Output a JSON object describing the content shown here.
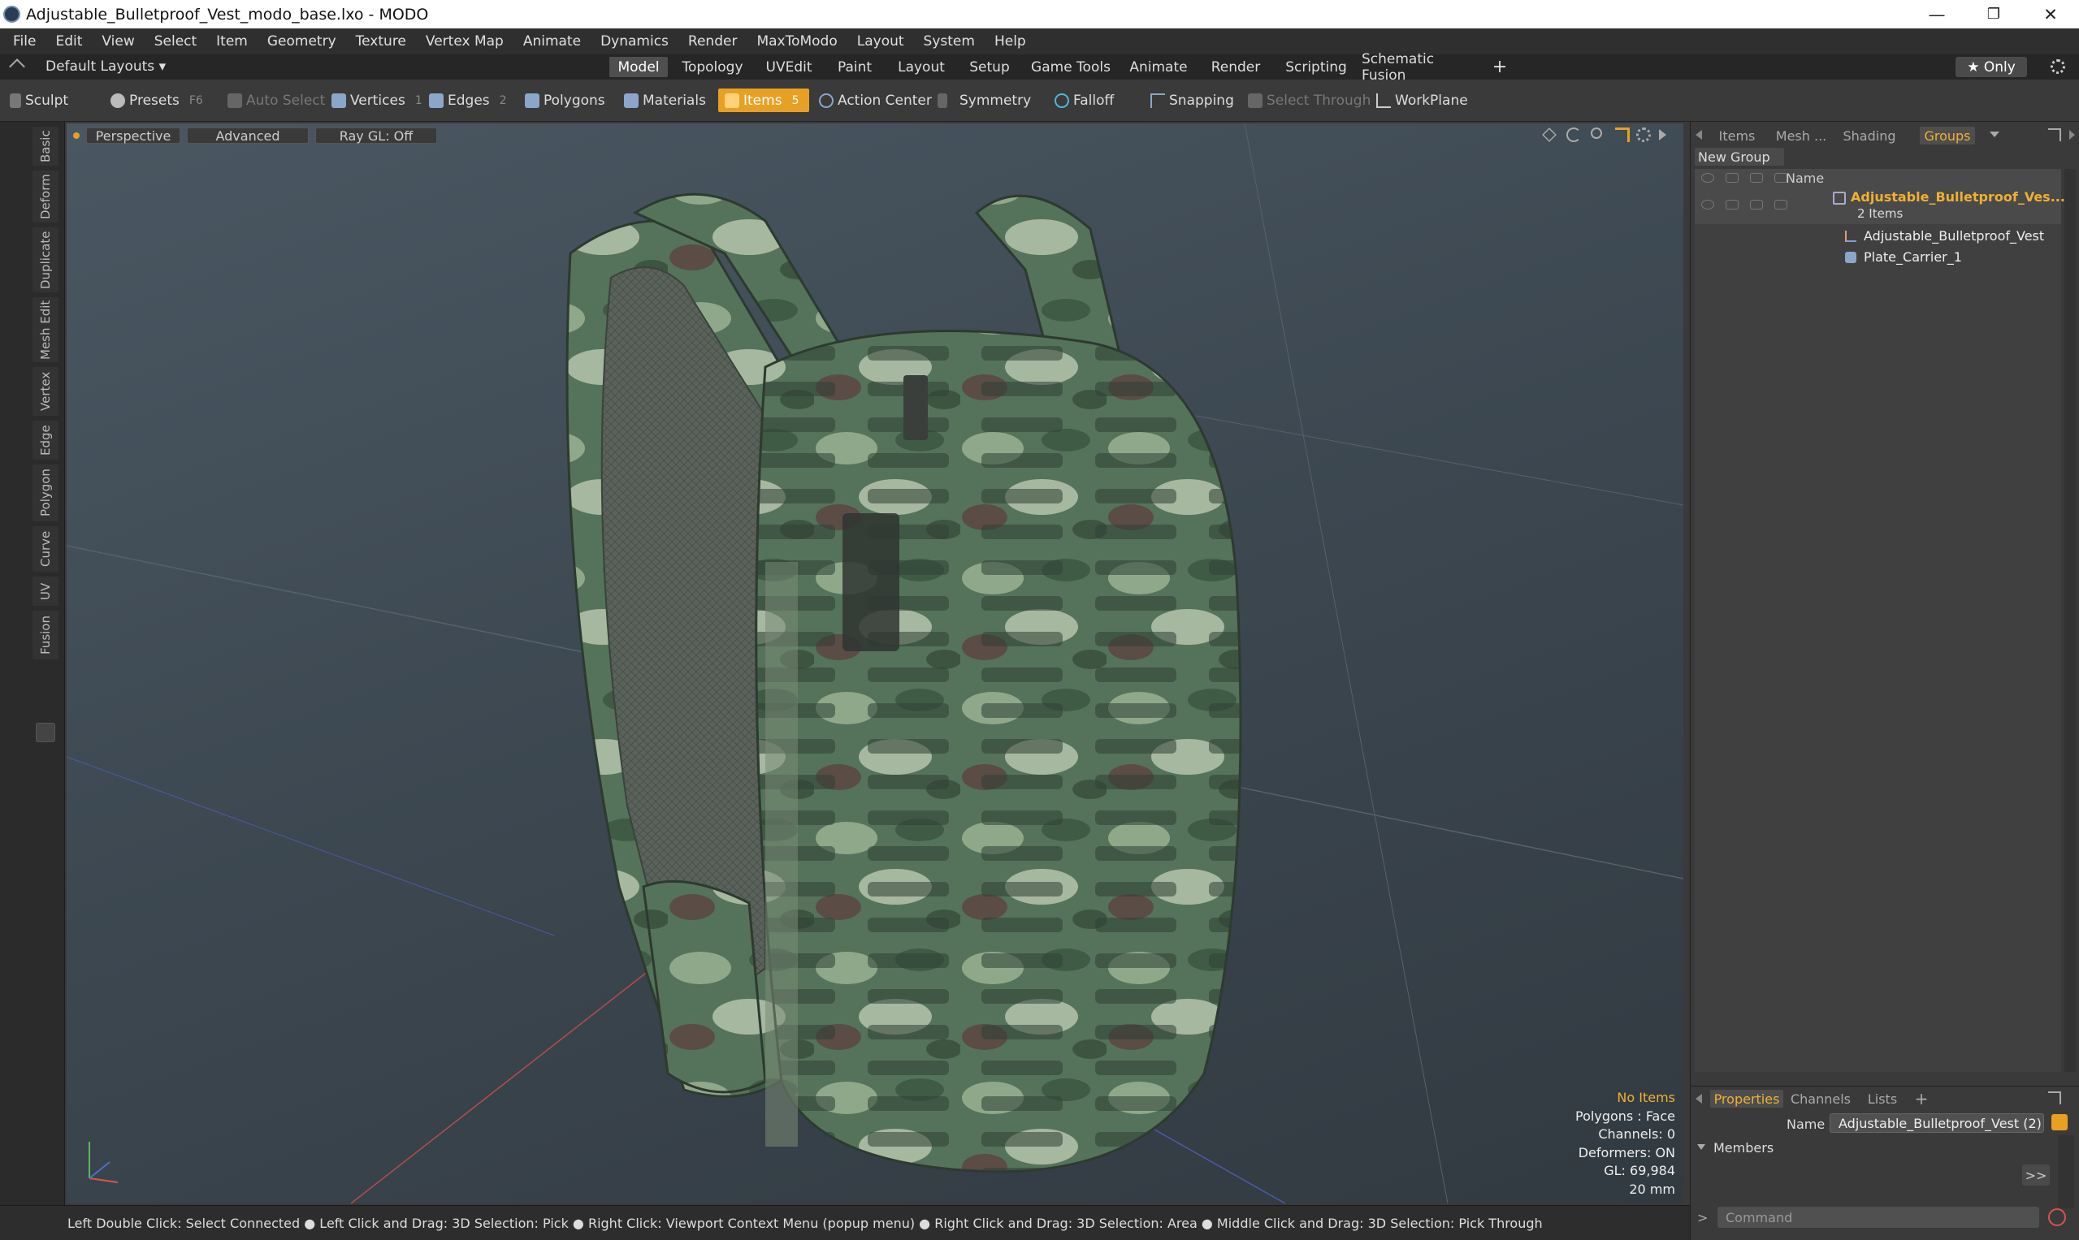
{
  "window": {
    "title": "Adjustable_Bulletproof_Vest_modo_base.lxo - MODO",
    "minimize": "—",
    "restore": "❐",
    "close": "✕"
  },
  "menu": [
    "File",
    "Edit",
    "View",
    "Select",
    "Item",
    "Geometry",
    "Texture",
    "Vertex Map",
    "Animate",
    "Dynamics",
    "Render",
    "MaxToModo",
    "Layout",
    "System",
    "Help"
  ],
  "layoutbar": {
    "layouts_label": "Default Layouts ▾",
    "tabs": [
      "Model",
      "Topology",
      "UVEdit",
      "Paint",
      "Layout",
      "Setup",
      "Game Tools",
      "Animate",
      "Render",
      "Scripting",
      "Schematic Fusion"
    ],
    "active_tab": "Model",
    "add": "+",
    "only_label": "★ Only"
  },
  "toolbar": {
    "sculpt": "Sculpt",
    "presets": "Presets",
    "presets_key": "F6",
    "auto_select": "Auto Select",
    "vertices": "Vertices",
    "vertices_n": "1",
    "edges": "Edges",
    "edges_n": "2",
    "polygons": "Polygons",
    "materials": "Materials",
    "items": "Items",
    "items_n": "5",
    "action_center": "Action Center",
    "symmetry": "Symmetry",
    "falloff": "Falloff",
    "snapping": "Snapping",
    "select_through": "Select Through",
    "workplane": "WorkPlane"
  },
  "left_tabs": [
    "Basic",
    "Deform",
    "Duplicate",
    "Mesh Edit",
    "Vertex",
    "Edge",
    "Polygon",
    "Curve",
    "UV",
    "Fusion"
  ],
  "viewport": {
    "perspective": "Perspective",
    "advanced": "Advanced",
    "raygl": "Ray GL: Off",
    "stats": {
      "selection": "No Items",
      "polygons": "Polygons : Face",
      "channels": "Channels: 0",
      "deformers": "Deformers: ON",
      "gl": "GL: 69,984",
      "scale": "20 mm"
    }
  },
  "statusbar": "Left Double Click: Select Connected ● Left Click and Drag: 3D Selection: Pick ● Right Click: Viewport Context Menu (popup menu) ● Right Click and Drag: 3D Selection: Area ● Middle Click and Drag: 3D Selection: Pick Through",
  "right_panel": {
    "tabs": [
      "Items",
      "Mesh ...",
      "Shading",
      "Groups"
    ],
    "active_tab": "Groups",
    "new_group": "New Group",
    "col_name": "Name",
    "group_name": "Adjustable_Bulletproof_Ves...",
    "group_count": "2 Items",
    "children": [
      "Adjustable_Bulletproof_Vest",
      "Plate_Carrier_1"
    ]
  },
  "properties": {
    "tabs": [
      "Properties",
      "Channels",
      "Lists"
    ],
    "active_tab": "Properties",
    "add": "+",
    "name_label": "Name",
    "name_value": "Adjustable_Bulletproof_Vest (2)",
    "members": "Members",
    "more": ">>"
  },
  "command": {
    "prompt": ">",
    "placeholder": "Command"
  },
  "colors": {
    "accent": "#e8a024",
    "highlight_text": "#f0b030"
  }
}
